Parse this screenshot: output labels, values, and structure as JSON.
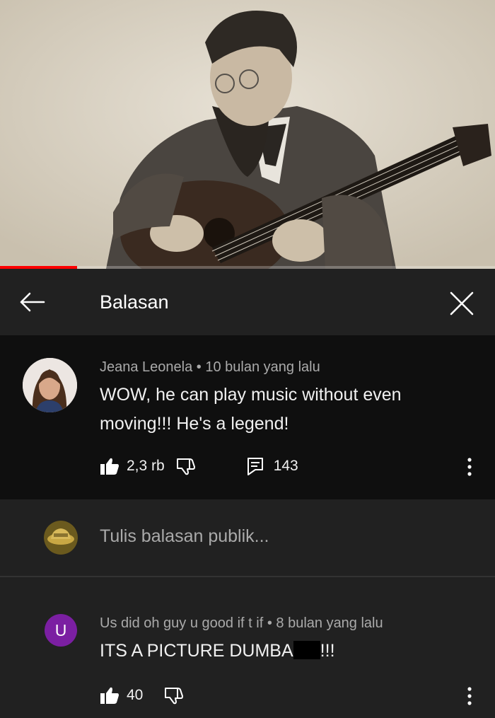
{
  "video": {
    "progress_fraction": 0.155
  },
  "header": {
    "title": "Balasan",
    "back_icon": "arrow-left-icon",
    "close_icon": "close-icon"
  },
  "main_comment": {
    "author": "Jeana Leonela",
    "separator": "•",
    "time": "10 bulan yang lalu",
    "text": "WOW, he can play music without even moving!!! He's a legend!",
    "likes": "2,3 rb",
    "replies": "143"
  },
  "reply_input": {
    "placeholder": "Tulis balasan publik..."
  },
  "reply_comment": {
    "avatar_letter": "U",
    "avatar_color": "#7b1fa2",
    "author": "Us did oh guy u good if t if",
    "separator": "•",
    "time": "8 bulan yang lalu",
    "text_before": "ITS A PICTURE DUMBA",
    "text_after": "!!!",
    "likes": "40"
  },
  "colors": {
    "progress": "#ff0000",
    "panel": "#212121",
    "highlight_panel": "#0f0f0f",
    "secondary_text": "#aaaaaa"
  }
}
